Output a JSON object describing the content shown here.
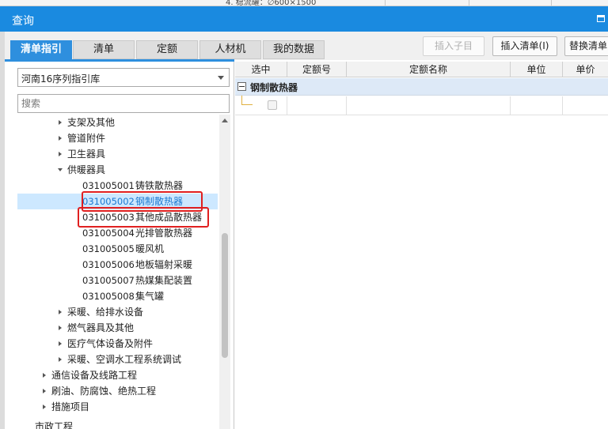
{
  "window": {
    "title": "查询"
  },
  "background_fragment": "4. 稳流罐：∅600×1500",
  "tabs": [
    {
      "label": "清单指引",
      "active": true
    },
    {
      "label": "清单",
      "active": false
    },
    {
      "label": "定额",
      "active": false
    },
    {
      "label": "人材机",
      "active": false
    },
    {
      "label": "我的数据",
      "active": false
    }
  ],
  "toolbar": {
    "insert_child": "插入子目",
    "insert_list": "插入清单(I)",
    "replace_list": "替换清单"
  },
  "library_select": {
    "value": "河南16序列指引库"
  },
  "search": {
    "placeholder": "搜索"
  },
  "tree": [
    {
      "label": "支架及其他",
      "expander": "closed"
    },
    {
      "label": "管道附件",
      "expander": "closed"
    },
    {
      "label": "卫生器具",
      "expander": "closed"
    },
    {
      "label": "供暖器具",
      "expander": "open"
    },
    {
      "code": "031005001",
      "label": "铸铁散热器"
    },
    {
      "code": "031005002",
      "label": "钢制散热器",
      "selected": true
    },
    {
      "code": "031005003",
      "label": "其他成品散热器"
    },
    {
      "code": "031005004",
      "label": "光排管散热器"
    },
    {
      "code": "031005005",
      "label": "暖风机"
    },
    {
      "code": "031005006",
      "label": "地板辐射采暖"
    },
    {
      "code": "031005007",
      "label": "热媒集配装置"
    },
    {
      "code": "031005008",
      "label": "集气罐"
    },
    {
      "label": "采暖、给排水设备",
      "expander": "closed"
    },
    {
      "label": "燃气器具及其他",
      "expander": "closed"
    },
    {
      "label": "医疗气体设备及附件",
      "expander": "closed"
    },
    {
      "label": "采暖、空调水工程系统调试",
      "expander": "closed"
    },
    {
      "label": "通信设备及线路工程",
      "expander": "closed"
    },
    {
      "label": "刷油、防腐蚀、绝热工程",
      "expander": "closed"
    },
    {
      "label": "措施项目",
      "expander": "closed"
    },
    {
      "label": "市政工程"
    }
  ],
  "grid": {
    "columns": [
      "选中",
      "定额号",
      "定额名称",
      "单位",
      "单价"
    ],
    "group_title": "钢制散热器"
  },
  "colors": {
    "title_bar": "#1a8ae0",
    "tab_active": "#2e8fde",
    "selection_highlight": "#cde8ff",
    "annotation": "#e02020"
  }
}
